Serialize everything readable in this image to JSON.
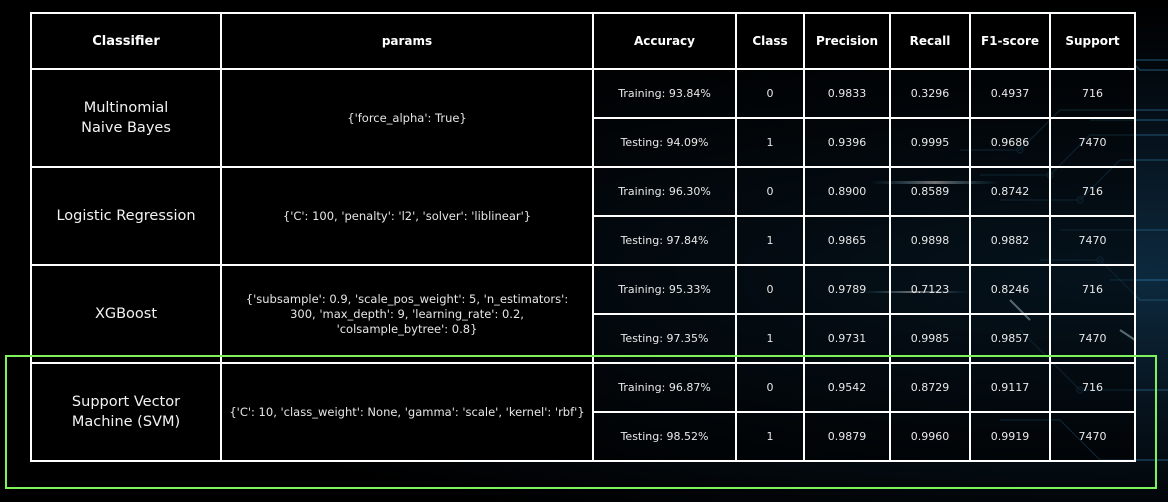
{
  "table": {
    "headers": [
      "Classifier",
      "params",
      "Accuracy",
      "Class",
      "Precision",
      "Recall",
      "F1-score",
      "Support"
    ],
    "groups": [
      {
        "classifier": "Multinomial Naive Bayes",
        "params": "{'force_alpha': True}",
        "rows": [
          {
            "accuracy": "Training: 93.84%",
            "class": "0",
            "precision": "0.9833",
            "recall": "0.3296",
            "f1": "0.4937",
            "support": "716"
          },
          {
            "accuracy": "Testing: 94.09%",
            "class": "1",
            "precision": "0.9396",
            "recall": "0.9995",
            "f1": "0.9686",
            "support": "7470"
          }
        ]
      },
      {
        "classifier": "Logistic Regression",
        "params": "{'C': 100, 'penalty': 'l2', 'solver': 'liblinear'}",
        "rows": [
          {
            "accuracy": "Training: 96.30%",
            "class": "0",
            "precision": "0.8900",
            "recall": "0.8589",
            "f1": "0.8742",
            "support": "716"
          },
          {
            "accuracy": "Testing: 97.84%",
            "class": "1",
            "precision": "0.9865",
            "recall": "0.9898",
            "f1": "0.9882",
            "support": "7470"
          }
        ]
      },
      {
        "classifier": "XGBoost",
        "params": "{'subsample': 0.9, 'scale_pos_weight': 5, 'n_estimators': 300, 'max_depth': 9, 'learning_rate': 0.2, 'colsample_bytree': 0.8}",
        "rows": [
          {
            "accuracy": "Training: 95.33%",
            "class": "0",
            "precision": "0.9789",
            "recall": "0.7123",
            "f1": "0.8246",
            "support": "716"
          },
          {
            "accuracy": "Testing: 97.35%",
            "class": "1",
            "precision": "0.9731",
            "recall": "0.9985",
            "f1": "0.9857",
            "support": "7470"
          }
        ]
      },
      {
        "classifier": "Support Vector Machine (SVM)",
        "params": "{'C': 10, 'class_weight': None, 'gamma': 'scale', 'kernel': 'rbf'}",
        "rows": [
          {
            "accuracy": "Training: 96.87%",
            "class": "0",
            "precision": "0.9542",
            "recall": "0.8729",
            "f1": "0.9117",
            "support": "716"
          },
          {
            "accuracy": "Testing: 98.52%",
            "class": "1",
            "precision": "0.9879",
            "recall": "0.9960",
            "f1": "0.9919",
            "support": "7470"
          }
        ]
      }
    ]
  },
  "colors": {
    "background": "#000000",
    "border": "#ffffff",
    "highlight": "#7ef25a",
    "accent_glow": "#4fc3ff"
  },
  "highlight": {
    "target_group": "Support Vector Machine (SVM)"
  }
}
